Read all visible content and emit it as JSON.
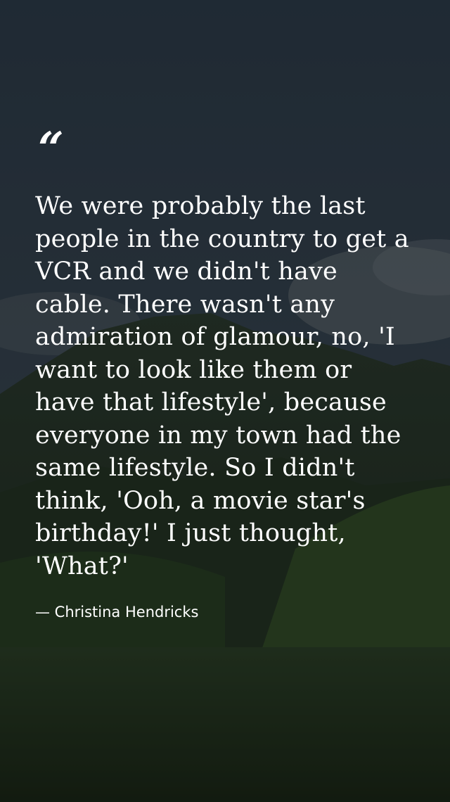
{
  "quote": {
    "mark": "“",
    "text": "We were probably the last people in the country to get a VCR and we didn't have cable. There wasn't any admiration of glamour, no, 'I want to look like them or have that lifestyle', because everyone in my town had the same lifestyle. So I didn't think, 'Ooh, a movie star's birthday!' I just thought, 'What?'",
    "author": "— Christina Hendricks"
  },
  "colors": {
    "text": "#ffffff",
    "sky": "#36464f",
    "hills": "#1f2e1d"
  }
}
